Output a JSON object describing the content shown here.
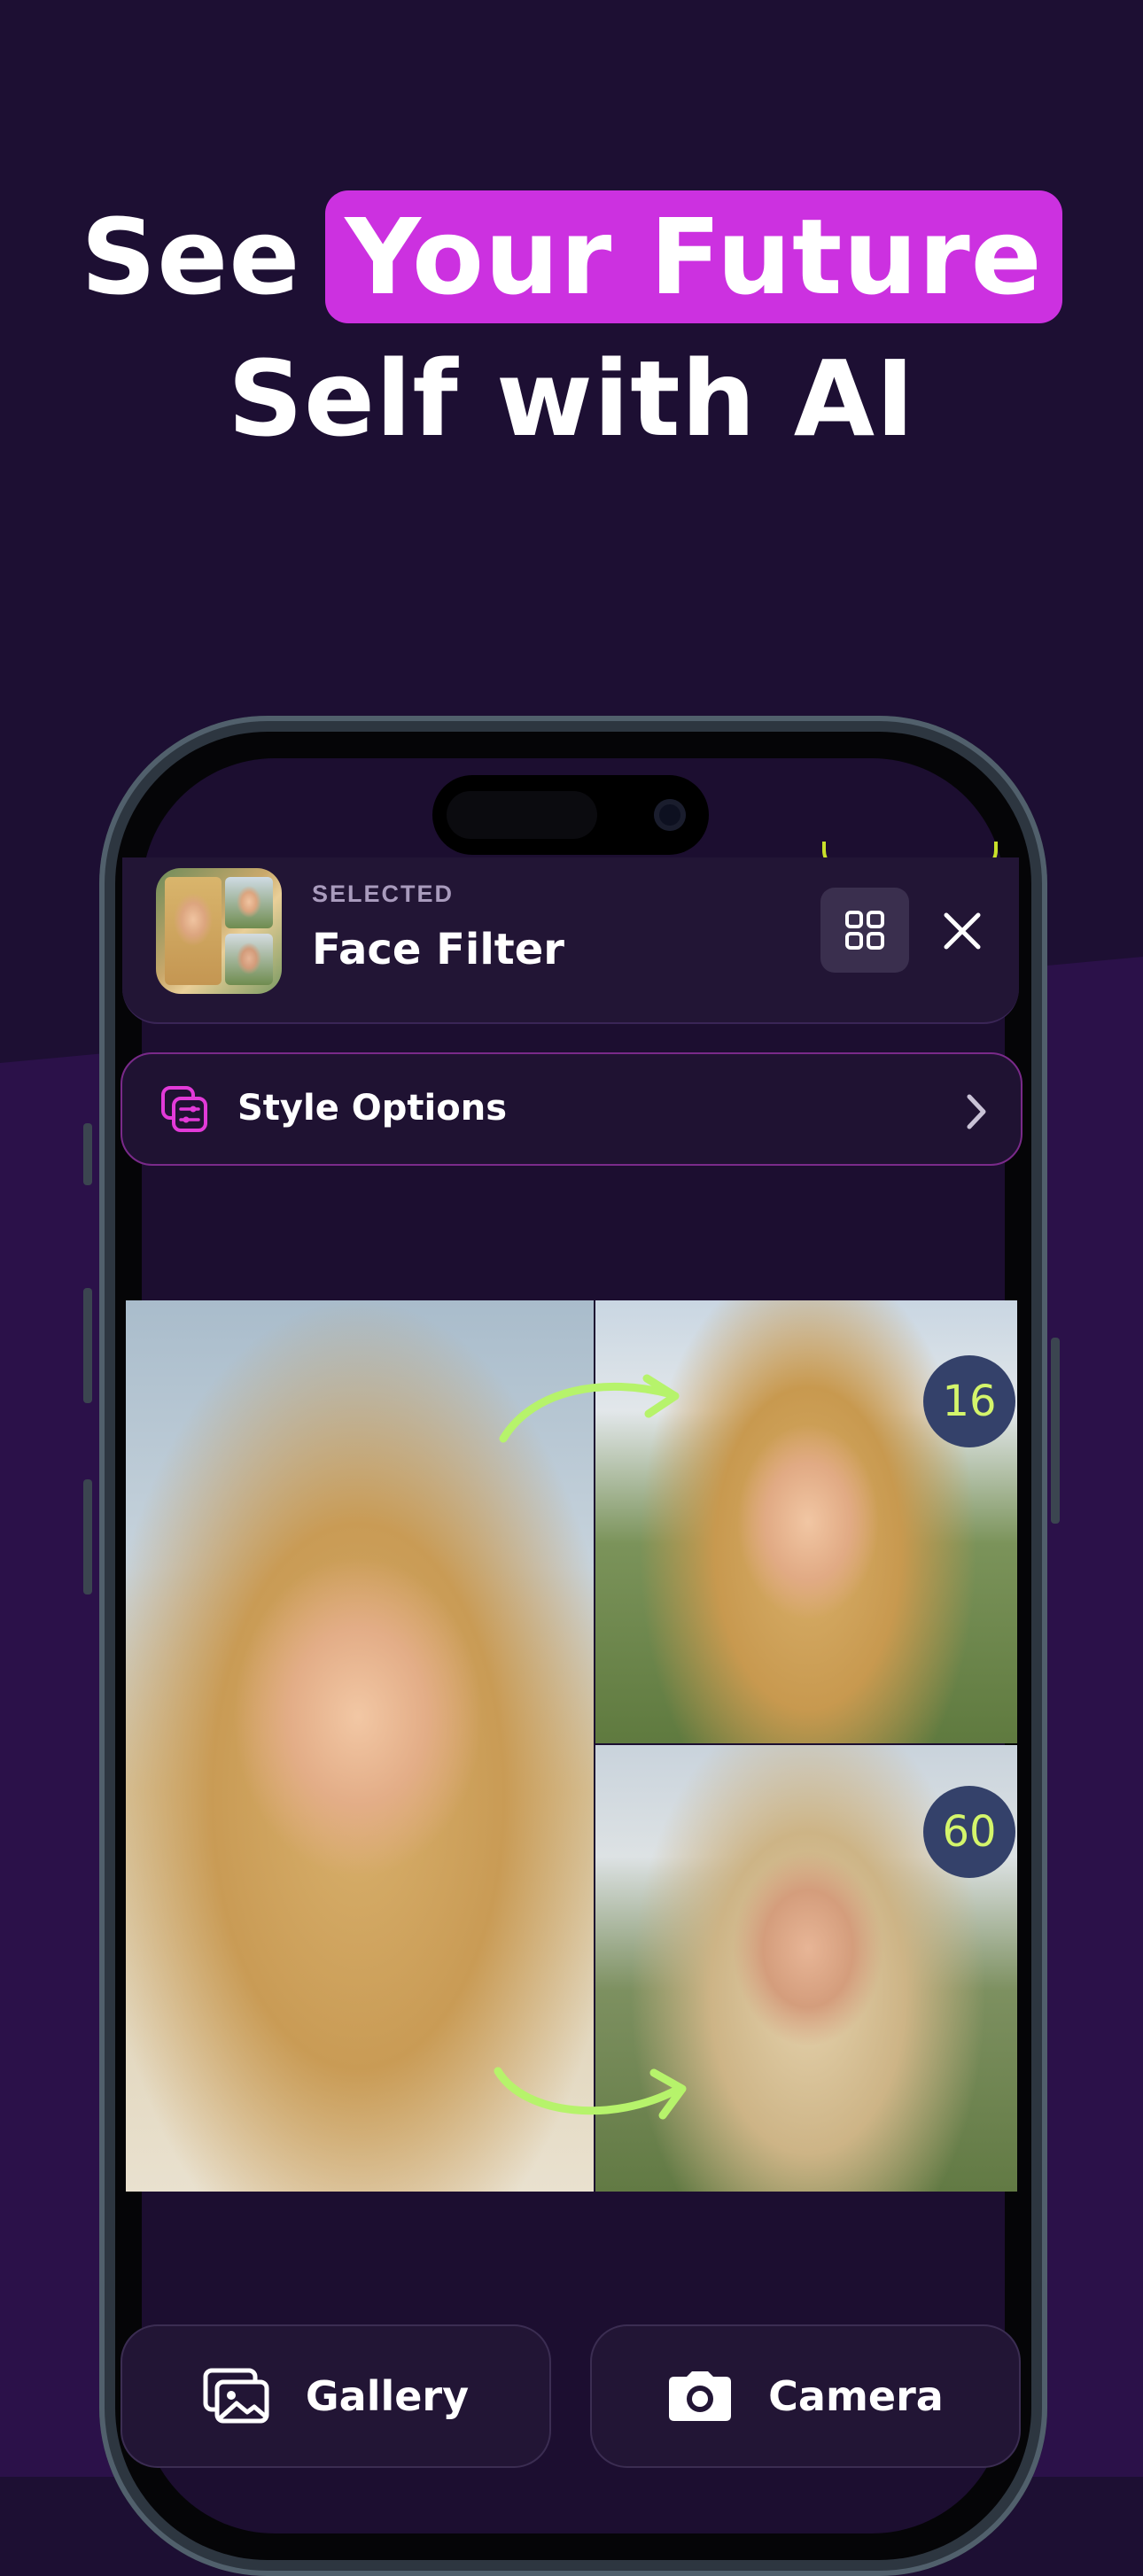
{
  "headline": {
    "line1_before": "See",
    "line1_highlight": "Your Future",
    "line2": "Self with AI"
  },
  "selected": {
    "label": "SELECTED",
    "title": "Face Filter",
    "thumbnail_icon": "face-filter-thumbnail",
    "grid_icon": "grid-icon",
    "close_icon": "close-icon"
  },
  "style_options": {
    "label": "Style Options",
    "icon": "style-options-icon",
    "chevron": "chevron-right-icon"
  },
  "comparison": {
    "young_age": "16",
    "old_age": "60"
  },
  "actions": {
    "gallery_label": "Gallery",
    "gallery_icon": "gallery-icon",
    "camera_label": "Camera",
    "camera_icon": "camera-icon"
  },
  "colors": {
    "background": "#1d0f33",
    "highlight": "#cc31e0",
    "accent_green": "#b6f36b",
    "style_border": "#7a2a8a",
    "badge": "#34416a"
  }
}
